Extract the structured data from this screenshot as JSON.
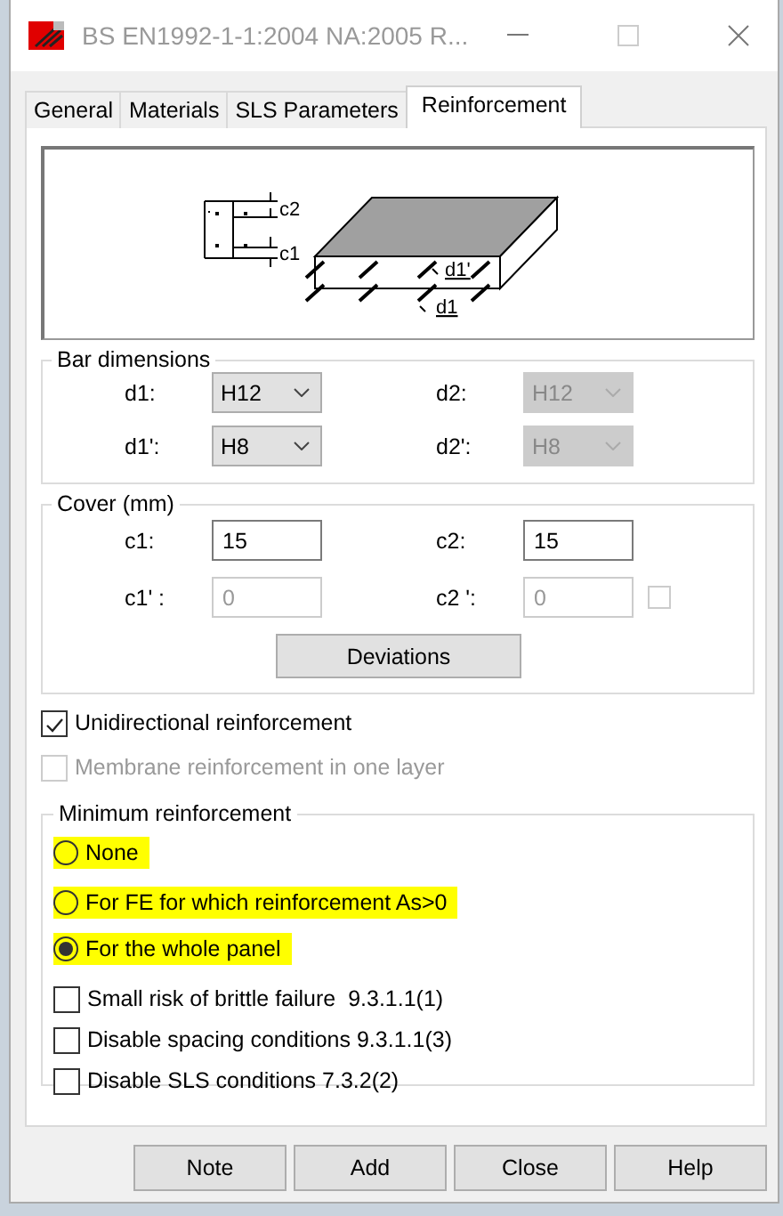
{
  "window": {
    "title": "BS EN1992-1-1:2004 NA:2005 R..."
  },
  "tabs": [
    {
      "label": "General",
      "selected": false
    },
    {
      "label": "Materials",
      "selected": false
    },
    {
      "label": "SLS Parameters",
      "selected": false
    },
    {
      "label": "Reinforcement",
      "selected": true
    }
  ],
  "diagram": {
    "labels": [
      "c2",
      "c1",
      "d1'",
      "d1"
    ]
  },
  "bar_dimensions": {
    "title": "Bar dimensions",
    "fields": [
      {
        "label": "d1:",
        "value": "H12",
        "disabled": false
      },
      {
        "label": "d2:",
        "value": "H12",
        "disabled": true
      },
      {
        "label": "d1':",
        "value": "H8",
        "disabled": false
      },
      {
        "label": "d2':",
        "value": "H8",
        "disabled": true
      }
    ]
  },
  "cover": {
    "title": "Cover (mm)",
    "fields": [
      {
        "label": "c1:",
        "value": "15",
        "disabled": false
      },
      {
        "label": "c2:",
        "value": "15",
        "disabled": false
      },
      {
        "label": "c1' :",
        "value": "0",
        "disabled": true
      },
      {
        "label": "c2 ':",
        "value": "0",
        "disabled": true
      }
    ],
    "extra_checkbox": {
      "checked": false,
      "disabled": true
    },
    "button": "Deviations"
  },
  "options": [
    {
      "label": "Unidirectional reinforcement",
      "checked": true,
      "disabled": false
    },
    {
      "label": "Membrane reinforcement in one layer",
      "checked": false,
      "disabled": true
    }
  ],
  "minimum": {
    "title": "Minimum reinforcement",
    "radios": [
      {
        "label": "None",
        "selected": false,
        "highlighted": true
      },
      {
        "label": "For FE for which reinforcement As>0",
        "selected": false,
        "highlighted": true
      },
      {
        "label": "For the whole panel",
        "selected": true,
        "highlighted": true
      }
    ],
    "checkboxes": [
      {
        "label": "Small risk of brittle failure  9.3.1.1(1)",
        "checked": false
      },
      {
        "label": "Disable spacing conditions 9.3.1.1(3)",
        "checked": false
      },
      {
        "label": "Disable SLS conditions 7.3.2(2)",
        "checked": false
      }
    ]
  },
  "buttons": [
    "Note",
    "Add",
    "Close",
    "Help"
  ]
}
